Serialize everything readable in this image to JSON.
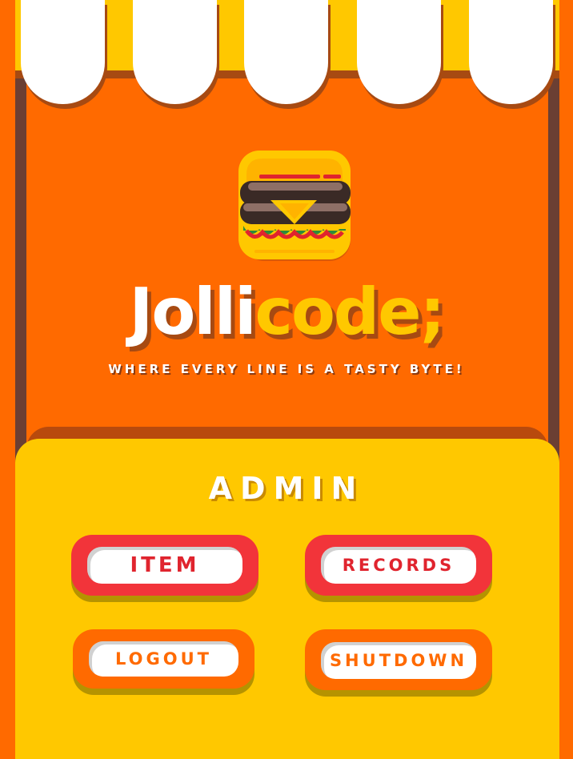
{
  "brand": {
    "name_part1": "Jolli",
    "name_part2": "code;",
    "tagline": "WHERE EVERY LINE IS A TASTY BYTE!",
    "logo_icon": "burger-icon"
  },
  "panel": {
    "title": "ADMIN"
  },
  "buttons": {
    "item": "ITEM",
    "records": "RECORDS",
    "logout": "LOGOUT",
    "shutdown": "SHUTDOWN"
  },
  "colors": {
    "background": "#FF6A00",
    "awning_yellow": "#FFC800",
    "panel_yellow": "#FFC800",
    "button_red": "#F2343A",
    "button_orange": "#FF6A00",
    "frame_brown": "#6B3F33"
  }
}
